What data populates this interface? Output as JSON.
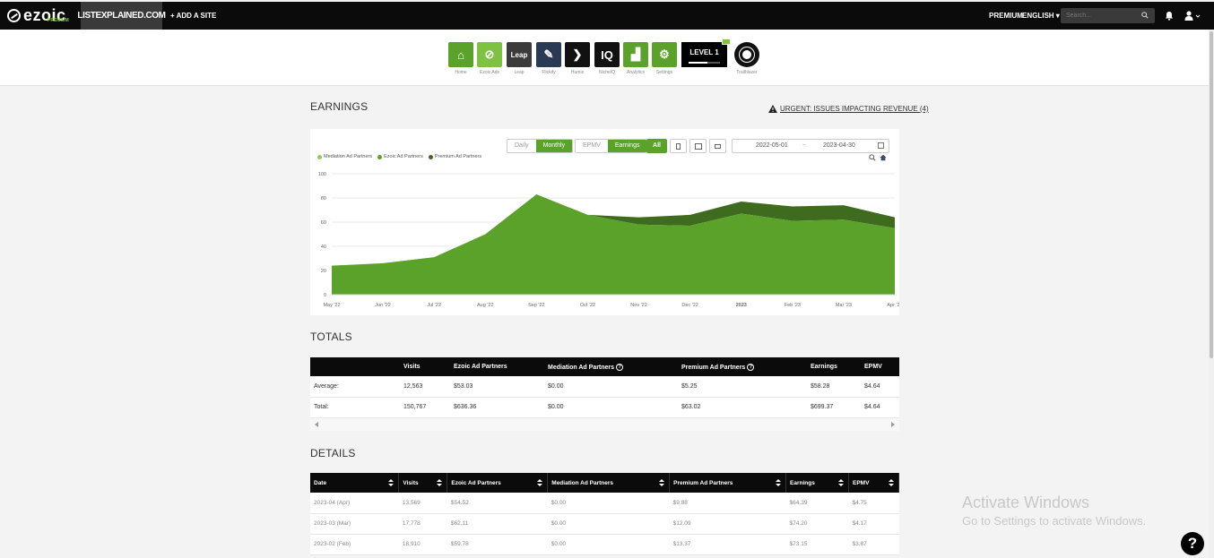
{
  "topbar": {
    "logo": "ezoic",
    "logo_sub": "PREMIUM",
    "site": "LISTEXPLAINED.COM",
    "add_site": "+ ADD A SITE",
    "premium": "PREMIUM",
    "language": "ENGLISH",
    "search_placeholder": "Search..."
  },
  "apps": [
    {
      "label": "Home",
      "color": "#5aa22a",
      "glyph": "⌂"
    },
    {
      "label": "Ezoic Ads",
      "color": "#7dc242",
      "glyph": "⊘"
    },
    {
      "label": "Leap",
      "color": "#3b3b3b",
      "glyph": "Leap"
    },
    {
      "label": "Flickify",
      "color": "#2a3a55",
      "glyph": "✎"
    },
    {
      "label": "Humix",
      "color": "#111111",
      "glyph": "❯"
    },
    {
      "label": "NicheIQ",
      "color": "#111111",
      "glyph": "IQ"
    },
    {
      "label": "Analytics",
      "color": "#5aa22a",
      "glyph": "▟"
    },
    {
      "label": "Settings",
      "color": "#5aa22a",
      "glyph": "⚙"
    }
  ],
  "level": {
    "label": "LEVEL 1",
    "progress": 0.6
  },
  "trailblazer": {
    "label": "Trailblazer"
  },
  "earnings": {
    "title": "EARNINGS",
    "urgent": "URGENT: ISSUES IMPACTING REVENUE (4)",
    "toggle_period": [
      "Daily",
      "Monthly"
    ],
    "active_period": "Monthly",
    "toggle_metric": [
      "EPMV",
      "Earnings"
    ],
    "active_metric": "Earnings",
    "device_all": "All",
    "date_start": "2022-05-01",
    "date_sep": "~",
    "date_end": "2023-04-30"
  },
  "chart_data": {
    "type": "area",
    "stacked": true,
    "x": [
      "May '22",
      "Jun '22",
      "Jul '22",
      "Aug '22",
      "Sep '22",
      "Oct '22",
      "Nov '22",
      "Dec '22",
      "2023",
      "Feb '23",
      "Mar '23",
      "Apr '23"
    ],
    "ylim": [
      0,
      100
    ],
    "yticks": [
      0,
      20,
      40,
      60,
      80,
      100
    ],
    "legend_position": "top-left",
    "series": [
      {
        "name": "Mediation Ad Partners",
        "color": "#8fce5a",
        "values": [
          0,
          0,
          0,
          0,
          0,
          0,
          0,
          0,
          0,
          0,
          0,
          0
        ]
      },
      {
        "name": "Ezoic Ad Partners",
        "color": "#5aa22a",
        "values": [
          24,
          26,
          31,
          50,
          83,
          66,
          58,
          57,
          67,
          61,
          62,
          55
        ]
      },
      {
        "name": "Premium Ad Partners",
        "color": "#3e6b1e",
        "values": [
          0,
          0,
          0,
          0,
          0,
          0,
          6,
          9,
          10,
          12,
          12,
          9
        ]
      }
    ]
  },
  "totals": {
    "title": "TOTALS",
    "headers": [
      "",
      "Visits",
      "Ezoic Ad Partners",
      "Mediation Ad Partners",
      "Premium Ad Partners",
      "Earnings",
      "EPMV"
    ],
    "help_glyph": "?",
    "rows": [
      [
        "Average:",
        "12,563",
        "$53.03",
        "$0.00",
        "$5.25",
        "$58.28",
        "$4.64"
      ],
      [
        "Total:",
        "150,767",
        "$636.36",
        "$0.00",
        "$63.02",
        "$699.37",
        "$4.64"
      ]
    ]
  },
  "details": {
    "title": "DETAILS",
    "headers": [
      "Date",
      "Visits",
      "Ezoic Ad Partners",
      "Mediation Ad Partners",
      "Premium Ad Partners",
      "Earnings",
      "EPMV"
    ],
    "rows": [
      [
        "2023-04 (Apr)",
        "13,569",
        "$54.52",
        "$0.00",
        "$9.88",
        "$64.39",
        "$4.75"
      ],
      [
        "2023-03 (Mar)",
        "17,778",
        "$62.11",
        "$0.00",
        "$12.09",
        "$74.20",
        "$4.17"
      ],
      [
        "2023-02 (Feb)",
        "18,910",
        "$59.78",
        "$0.00",
        "$13.37",
        "$73.15",
        "$3.87"
      ]
    ]
  },
  "watermark": {
    "line1": "Activate Windows",
    "line2": "Go to Settings to activate Windows."
  },
  "help": "?"
}
